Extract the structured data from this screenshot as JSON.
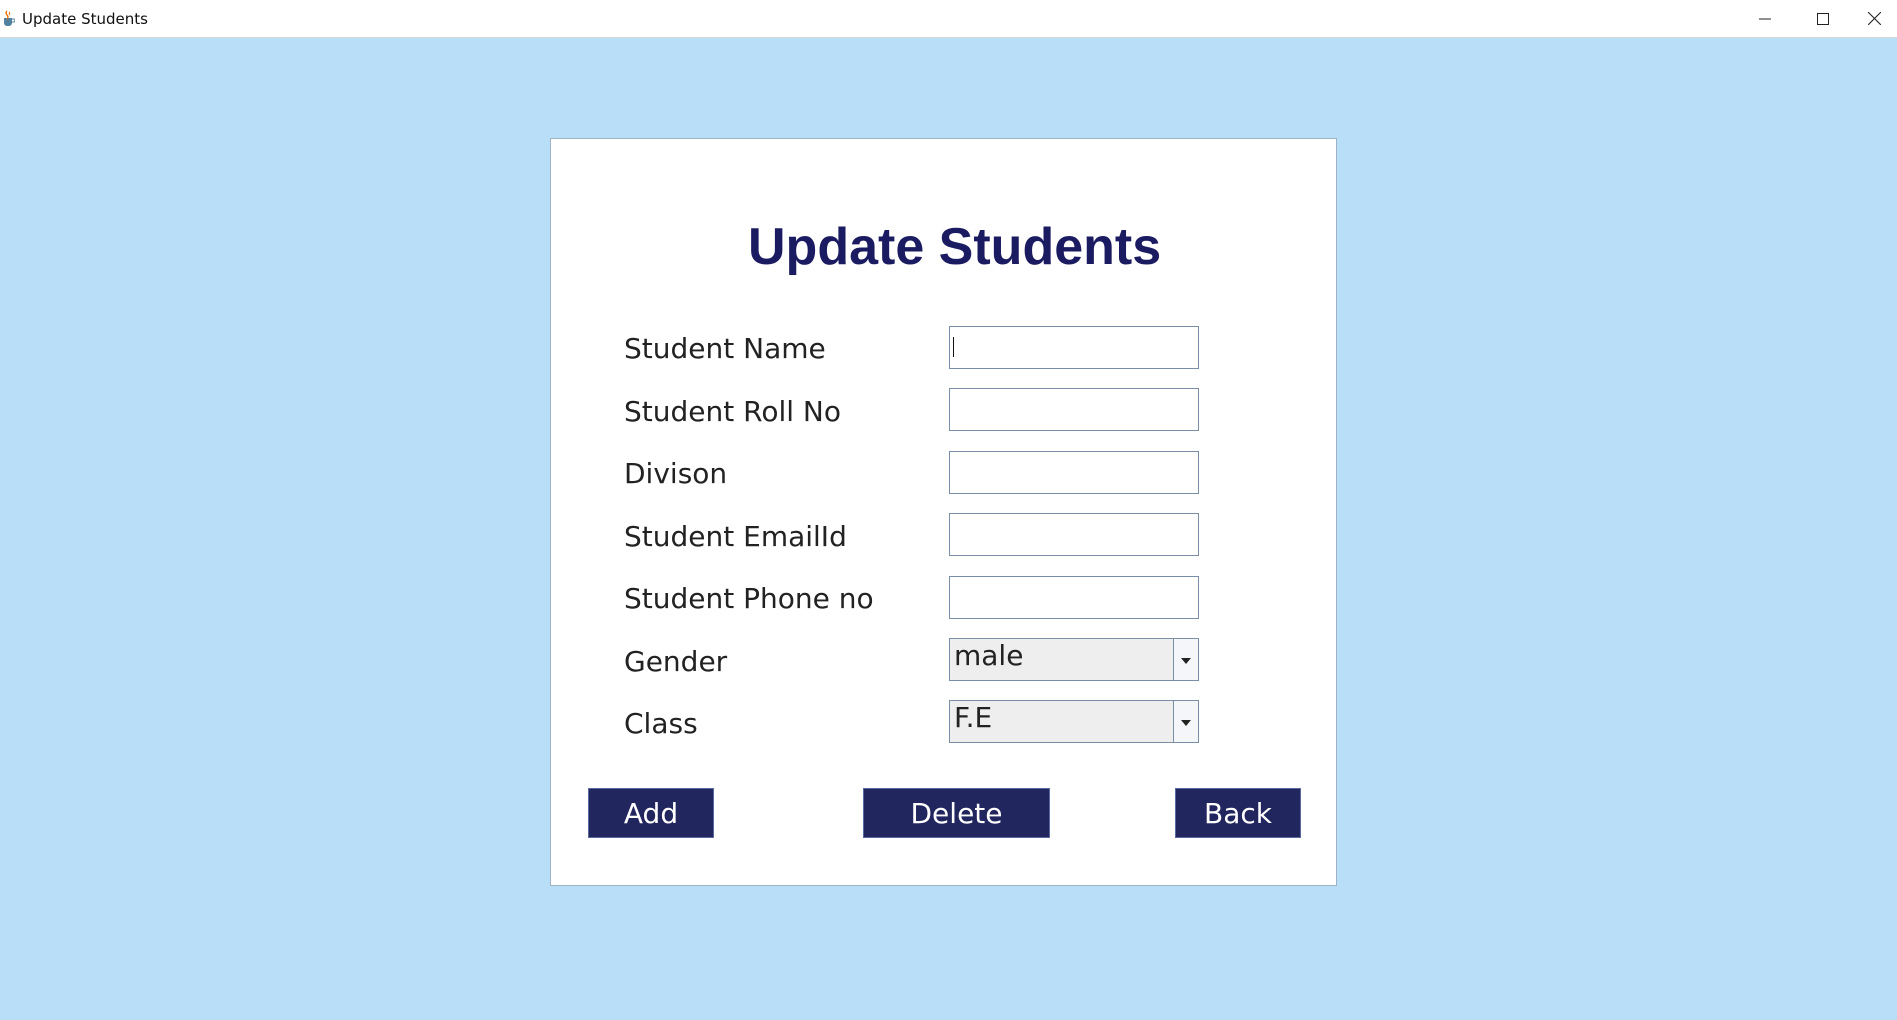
{
  "window": {
    "title": "Update Students",
    "app_icon": "java-cup-icon",
    "controls": [
      "minimize-icon",
      "maximize-icon",
      "close-icon"
    ]
  },
  "form": {
    "heading": "Update Students",
    "fields": [
      {
        "label": "Student Name",
        "value": "",
        "type": "text"
      },
      {
        "label": "Student Roll No",
        "value": "",
        "type": "text"
      },
      {
        "label": "Divison",
        "value": "",
        "type": "text"
      },
      {
        "label": "Student EmailId",
        "value": "",
        "type": "text"
      },
      {
        "label": "Student Phone no",
        "value": "",
        "type": "text"
      },
      {
        "label": "Gender",
        "value": "male",
        "type": "select"
      },
      {
        "label": "Class",
        "value": "F.E",
        "type": "select"
      }
    ],
    "buttons": {
      "add": "Add",
      "delete": "Delete",
      "back": "Back"
    }
  },
  "colors": {
    "background": "#b9def7",
    "heading": "#1b1b61",
    "button": "#22265e",
    "button_text": "#ffffff"
  }
}
